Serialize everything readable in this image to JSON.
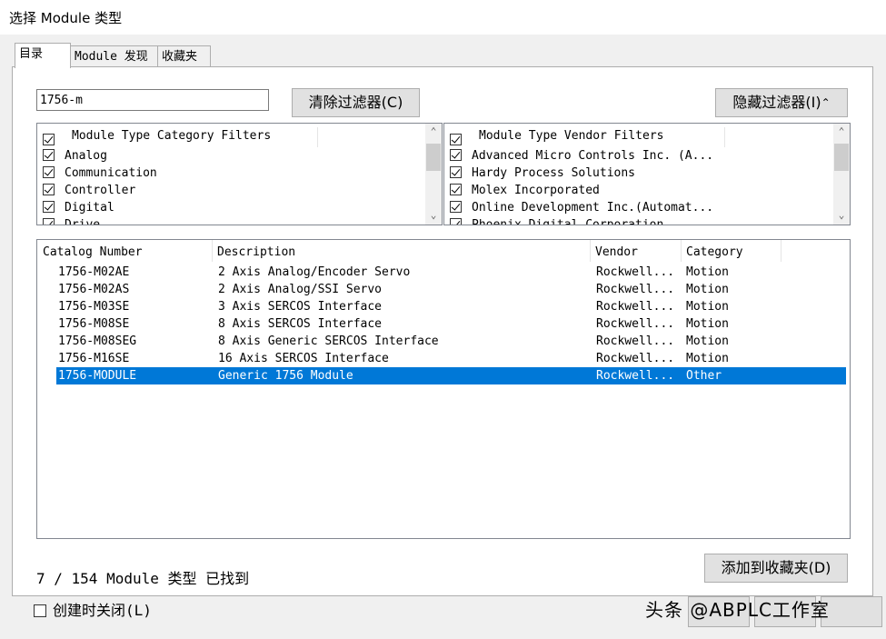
{
  "window": {
    "title": "选择 Module 类型"
  },
  "tabs": [
    {
      "label": "目录",
      "active": true
    },
    {
      "label": "Module 发现",
      "active": false
    },
    {
      "label": "收藏夹",
      "active": false
    }
  ],
  "search": {
    "value": "1756-m"
  },
  "buttons": {
    "clear_filters": "清除过滤器(C)",
    "hide_filters": "隐藏过滤器(I)",
    "hide_filters_icon": "double-chevron-up-icon",
    "add_favorites": "添加到收藏夹(D)"
  },
  "category_filters": {
    "header": "Module Type Category Filters",
    "items": [
      {
        "label": "Analog",
        "checked": true
      },
      {
        "label": "Communication",
        "checked": true
      },
      {
        "label": "Controller",
        "checked": true
      },
      {
        "label": "Digital",
        "checked": true
      },
      {
        "label": "Drive",
        "checked": true
      }
    ]
  },
  "vendor_filters": {
    "header": "Module Type Vendor Filters",
    "items": [
      {
        "label": "Advanced Micro Controls Inc.  (A...",
        "checked": true
      },
      {
        "label": "Hardy Process Solutions",
        "checked": true
      },
      {
        "label": "Molex Incorporated",
        "checked": true
      },
      {
        "label": "Online Development Inc.(Automat...",
        "checked": true
      },
      {
        "label": "Phoenix Digital Corporation",
        "checked": true
      }
    ]
  },
  "catalog": {
    "columns": [
      "Catalog Number",
      "Description",
      "Vendor",
      "Category"
    ],
    "rows": [
      [
        "1756-M02AE",
        "2 Axis Analog/Encoder Servo",
        "Rockwell...",
        "Motion"
      ],
      [
        "1756-M02AS",
        "2 Axis Analog/SSI Servo",
        "Rockwell...",
        "Motion"
      ],
      [
        "1756-M03SE",
        "3 Axis SERCOS Interface",
        "Rockwell...",
        "Motion"
      ],
      [
        "1756-M08SE",
        "8 Axis SERCOS Interface",
        "Rockwell...",
        "Motion"
      ],
      [
        "1756-M08SEG",
        "8 Axis Generic SERCOS Interface",
        "Rockwell...",
        "Motion"
      ],
      [
        "1756-M16SE",
        "16 Axis SERCOS Interface",
        "Rockwell...",
        "Motion"
      ],
      [
        "1756-MODULE",
        "Generic 1756 Module",
        "Rockwell...",
        "Other"
      ]
    ],
    "selected_index": 6
  },
  "status": "7 / 154 Module 类型 已找到",
  "close_on_create": {
    "label": "创建时关闭(L)",
    "checked": false
  },
  "watermark": "头条 @ABPLC工作室",
  "colors": {
    "selection": "#0078d7",
    "dialog_bg": "#f0f0f0"
  }
}
